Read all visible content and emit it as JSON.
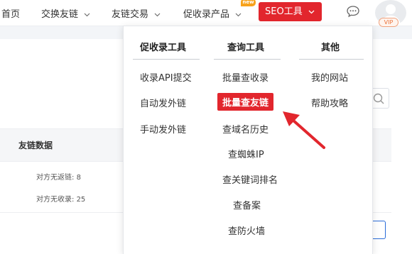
{
  "nav": {
    "home": "首页",
    "exchange": "交换友链",
    "trade": "友链交易",
    "products": "促收录产品",
    "seo_tools": "SEO工具",
    "new_badge": "new",
    "vip": "VIP"
  },
  "colors": {
    "accent": "#e2262d",
    "badge": "#f7a21b"
  },
  "dropdown": {
    "columns": [
      {
        "title": "促收录工具",
        "items": [
          "收录API提交",
          "自动发外链",
          "手动发外链"
        ]
      },
      {
        "title": "查询工具",
        "items": [
          "批量查收录",
          "批量查友链",
          "查域名历史",
          "查蜘蛛IP",
          "查关键词排名",
          "查备案",
          "查防火墙"
        ]
      },
      {
        "title": "其他",
        "items": [
          "我的网站",
          "帮助攻略"
        ]
      }
    ],
    "active_item": "批量查友链"
  },
  "table": {
    "header": "友链数据",
    "row": {
      "line1_label": "对方无返链",
      "line1_value": "8",
      "line2_label": "对方无收录",
      "line2_value": "25"
    }
  },
  "icons": {
    "chevron": "chevron-down-icon",
    "message": "message-icon",
    "avatar": "avatar-icon",
    "pointer": "red-arrow-icon"
  }
}
